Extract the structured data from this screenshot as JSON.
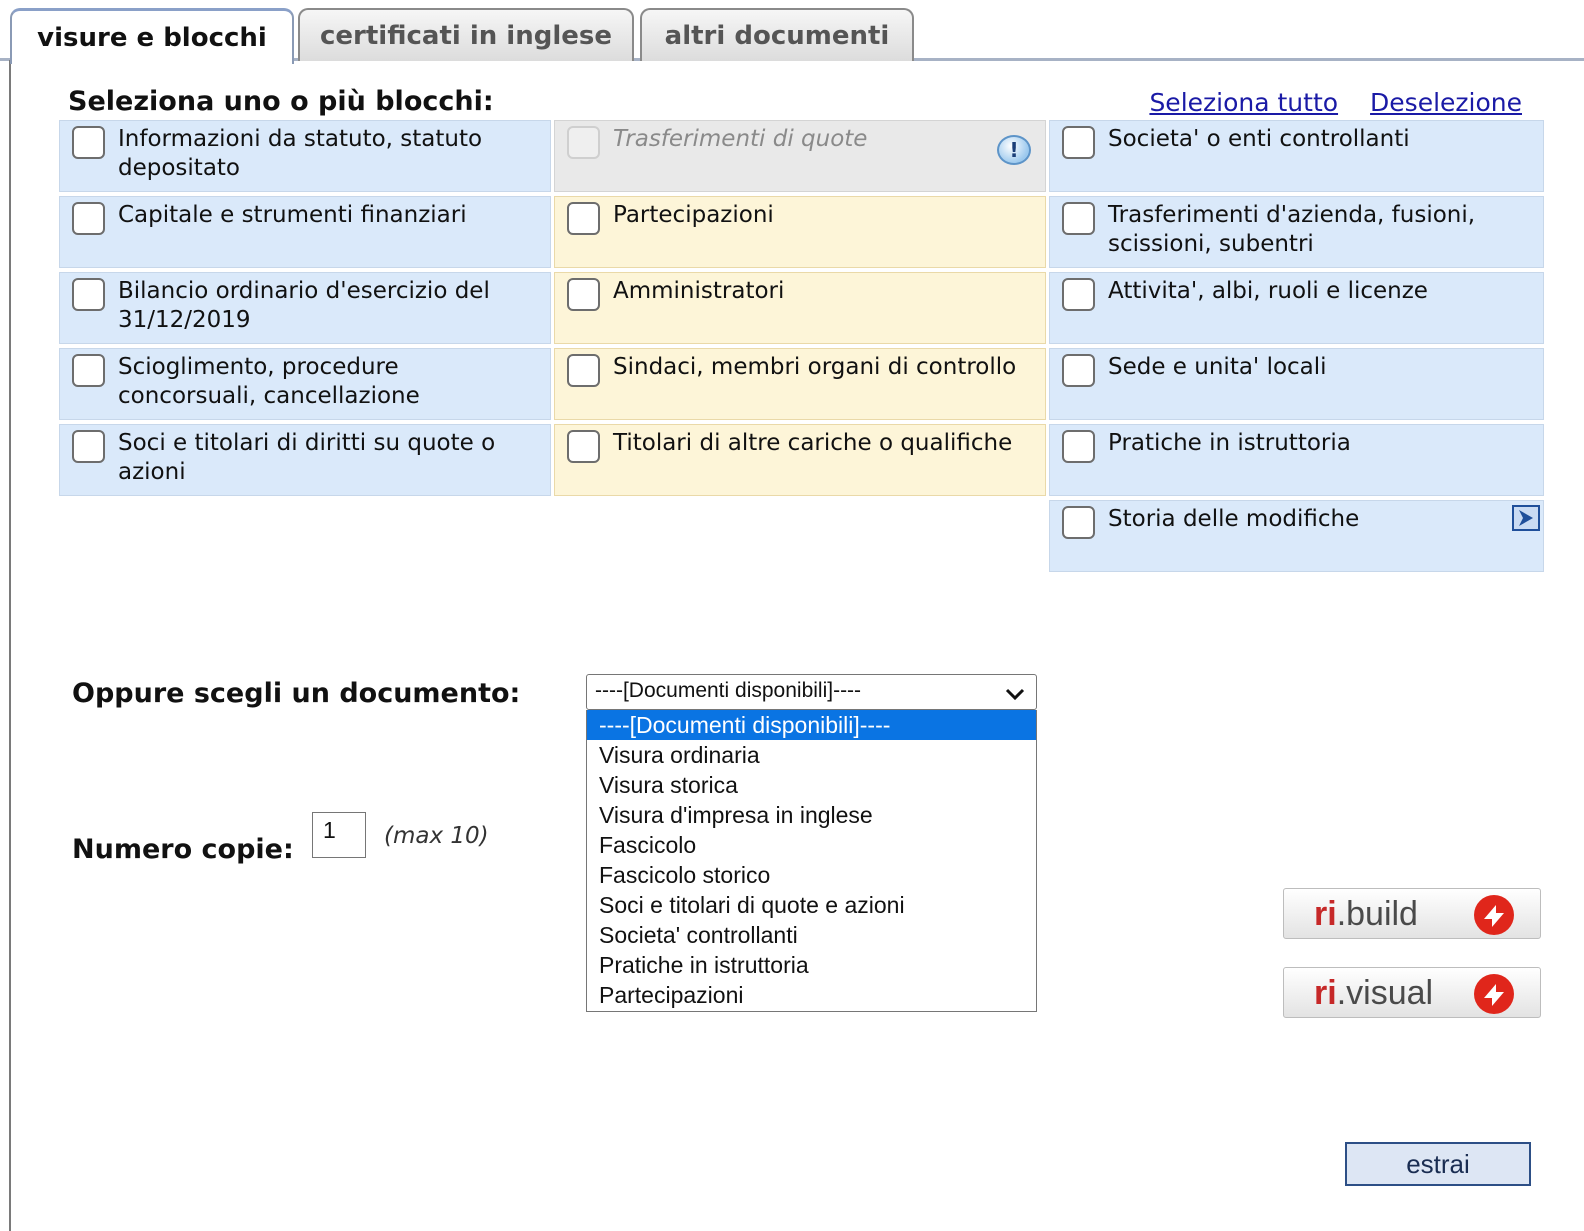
{
  "tabs": [
    {
      "label": "visure e blocchi",
      "active": true
    },
    {
      "label": "certificati in inglese",
      "active": false
    },
    {
      "label": "altri documenti",
      "active": false
    }
  ],
  "heading": "Seleziona uno o più blocchi:",
  "links": {
    "select_all": "Seleziona tutto",
    "deselect": "Deselezione"
  },
  "blocks": {
    "col1": [
      "Informazioni da statuto, statuto depositato",
      "Capitale e strumenti finanziari",
      "Bilancio ordinario d'esercizio del 31/12/2019",
      "Scioglimento, procedure concorsuali, cancellazione",
      "Soci e titolari di diritti su quote o azioni"
    ],
    "col2": [
      "Trasferimenti di quote",
      "Partecipazioni",
      "Amministratori",
      "Sindaci, membri organi di controllo",
      "Titolari di altre cariche o qualifiche"
    ],
    "col3": [
      "Societa' o enti controllanti",
      "Trasferimenti d'azienda, fusioni, scissioni, subentri",
      "Attivita', albi, ruoli e licenze",
      "Sede e unita' locali",
      "Pratiche in istruttoria",
      "Storia delle modifiche"
    ]
  },
  "document": {
    "label": "Oppure scegli un documento:",
    "selected": "----[Documenti disponibili]----",
    "options": [
      "----[Documenti disponibili]----",
      "Visura ordinaria",
      "Visura storica",
      "Visura d'impresa in inglese",
      "Fascicolo",
      "Fascicolo storico",
      "Soci e titolari di quote e azioni",
      "Societa' controllanti",
      "Pratiche in istruttoria",
      "Partecipazioni"
    ]
  },
  "copies": {
    "label": "Numero copie:",
    "value": "1",
    "max_note": "(max 10)"
  },
  "side_buttons": {
    "build": {
      "prefix": "ri",
      "suffix": ".build"
    },
    "visual": {
      "prefix": "ri",
      "suffix": ".visual"
    }
  },
  "submit_label": "estrai",
  "icons": {
    "info": "info-alert-icon",
    "arrow": "arrow-right-icon",
    "logo": "ri-logo-icon"
  },
  "colors": {
    "blue_cell": "#dae9fa",
    "yellow_cell": "#fdf5d8",
    "gray_cell": "#e9e9e9",
    "selected_option": "#0a74e3",
    "link": "#1a1aa6"
  }
}
